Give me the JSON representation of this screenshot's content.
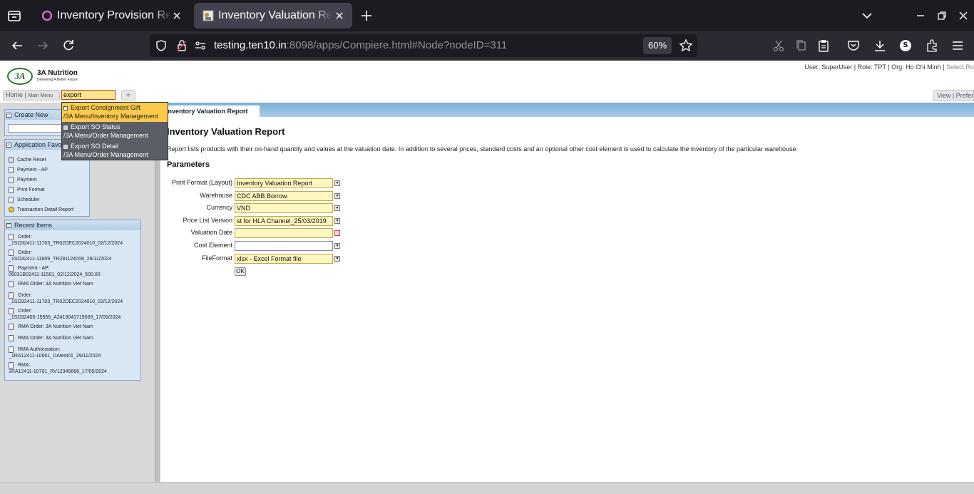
{
  "browser": {
    "tabs": [
      {
        "title": "Inventory Provision Report",
        "active": false
      },
      {
        "title": "Inventory Valuation Report",
        "active": true
      }
    ],
    "url_host": "testing.ten10.in",
    "url_rest": ":8098/apps/Compiere.html#Node?nodeID=311",
    "zoom": "60%",
    "profile_initial": "S"
  },
  "app": {
    "logo_mark": "3A",
    "brand_name": "3A Nutrition",
    "brand_tagline": "Delivering A Better Future",
    "user_info": "User: SuperUser  |  Role: TPT  |  Org: Ho Chi Minh  |",
    "select_role_link": "Select Ro",
    "menu_home": "Home |",
    "menu_main": "Main Menu",
    "search_value": "export",
    "plus_label": "+",
    "view_pref": "View | Prefer"
  },
  "search_results": [
    {
      "name": "Export Consignment Gift",
      "path": "/3A Menu/Inventory Management"
    },
    {
      "name": "Export SO Status",
      "path": "/3A Menu/Order Management"
    },
    {
      "name": "Export SO Detail",
      "path": "/3A Menu/Order Management"
    }
  ],
  "sidebar": {
    "create_new_title": "Create New",
    "favorites_title": "Application Favorites",
    "favorites": [
      {
        "label": "Cache Reset",
        "icon": "process-icon"
      },
      {
        "label": "Payment - AP",
        "icon": "window-icon"
      },
      {
        "label": "Payment",
        "icon": "window-icon"
      },
      {
        "label": "Print Format",
        "icon": "window-icon"
      },
      {
        "label": "Scheduler",
        "icon": "window-icon"
      },
      {
        "label": "Transaction Detail Report",
        "icon": "report-icon"
      }
    ],
    "recent_title": "Recent Items",
    "recent": [
      {
        "l1": "Order:",
        "l2": "_1SO32411-11703_TR02DEC2024010_02/12/2024"
      },
      {
        "l1": "Order:",
        "l2": "_1SO32411-11609_TR291124008_29/11/2024"
      },
      {
        "l1": "Payment - AP:",
        "l2": "06031B02411-11501_02/12/2024_500,00"
      },
      {
        "l1": "RMA Order: 3A Nutrition Viet Nam",
        "l2": ""
      },
      {
        "l1": "Order:",
        "l2": "_1SO32411-11703_TR02DEC2024010_02/12/2024"
      },
      {
        "l1": "Order:",
        "l2": "_1SO32405-15956_A2419041719569_17/05/2024"
      },
      {
        "l1": "RMA Order: 3A Nutrition Viet Nam",
        "l2": ""
      },
      {
        "l1": "RMA Order: 3A Nutrition Viet Nam",
        "l2": ""
      },
      {
        "l1": "RMA Authorization:",
        "l2": "_1RA12411-10601_DAtest01_29/11/2024"
      },
      {
        "l1": "RMA:",
        "l2": "1RA12411-10701_RV12345668_17/05/2024"
      }
    ]
  },
  "report": {
    "tab_label": "Inventory Valuation Report",
    "title": "Inventory Valuation Report",
    "description": "Report lists products with their on-hand quantity and values at the valuation date. In addition to several prices, standard costs and an optional other cost element is used to calculate the inventory of the particular warehouse.",
    "params_heading": "Parameters",
    "params": [
      {
        "label": "Print Format (Layout)",
        "value": "Inventory Valuation Report",
        "required": true,
        "button": "dropdown"
      },
      {
        "label": "Warehouse",
        "value": "CDC ABB Borrow",
        "required": true,
        "button": "dropdown"
      },
      {
        "label": "Currency",
        "value": "VND",
        "required": true,
        "button": "dropdown"
      },
      {
        "label": "Price List Version",
        "value": "st for HLA Channel_25/03/2019",
        "required": true,
        "button": "dropdown"
      },
      {
        "label": "Valuation Date",
        "value": "",
        "required": true,
        "button": "calendar"
      },
      {
        "label": "Cost Element",
        "value": "",
        "required": false,
        "button": "dropdown"
      },
      {
        "label": "FileFormat",
        "value": "xlsx - Excel Format file",
        "required": true,
        "button": "dropdown"
      }
    ],
    "ok_label": "OK"
  }
}
